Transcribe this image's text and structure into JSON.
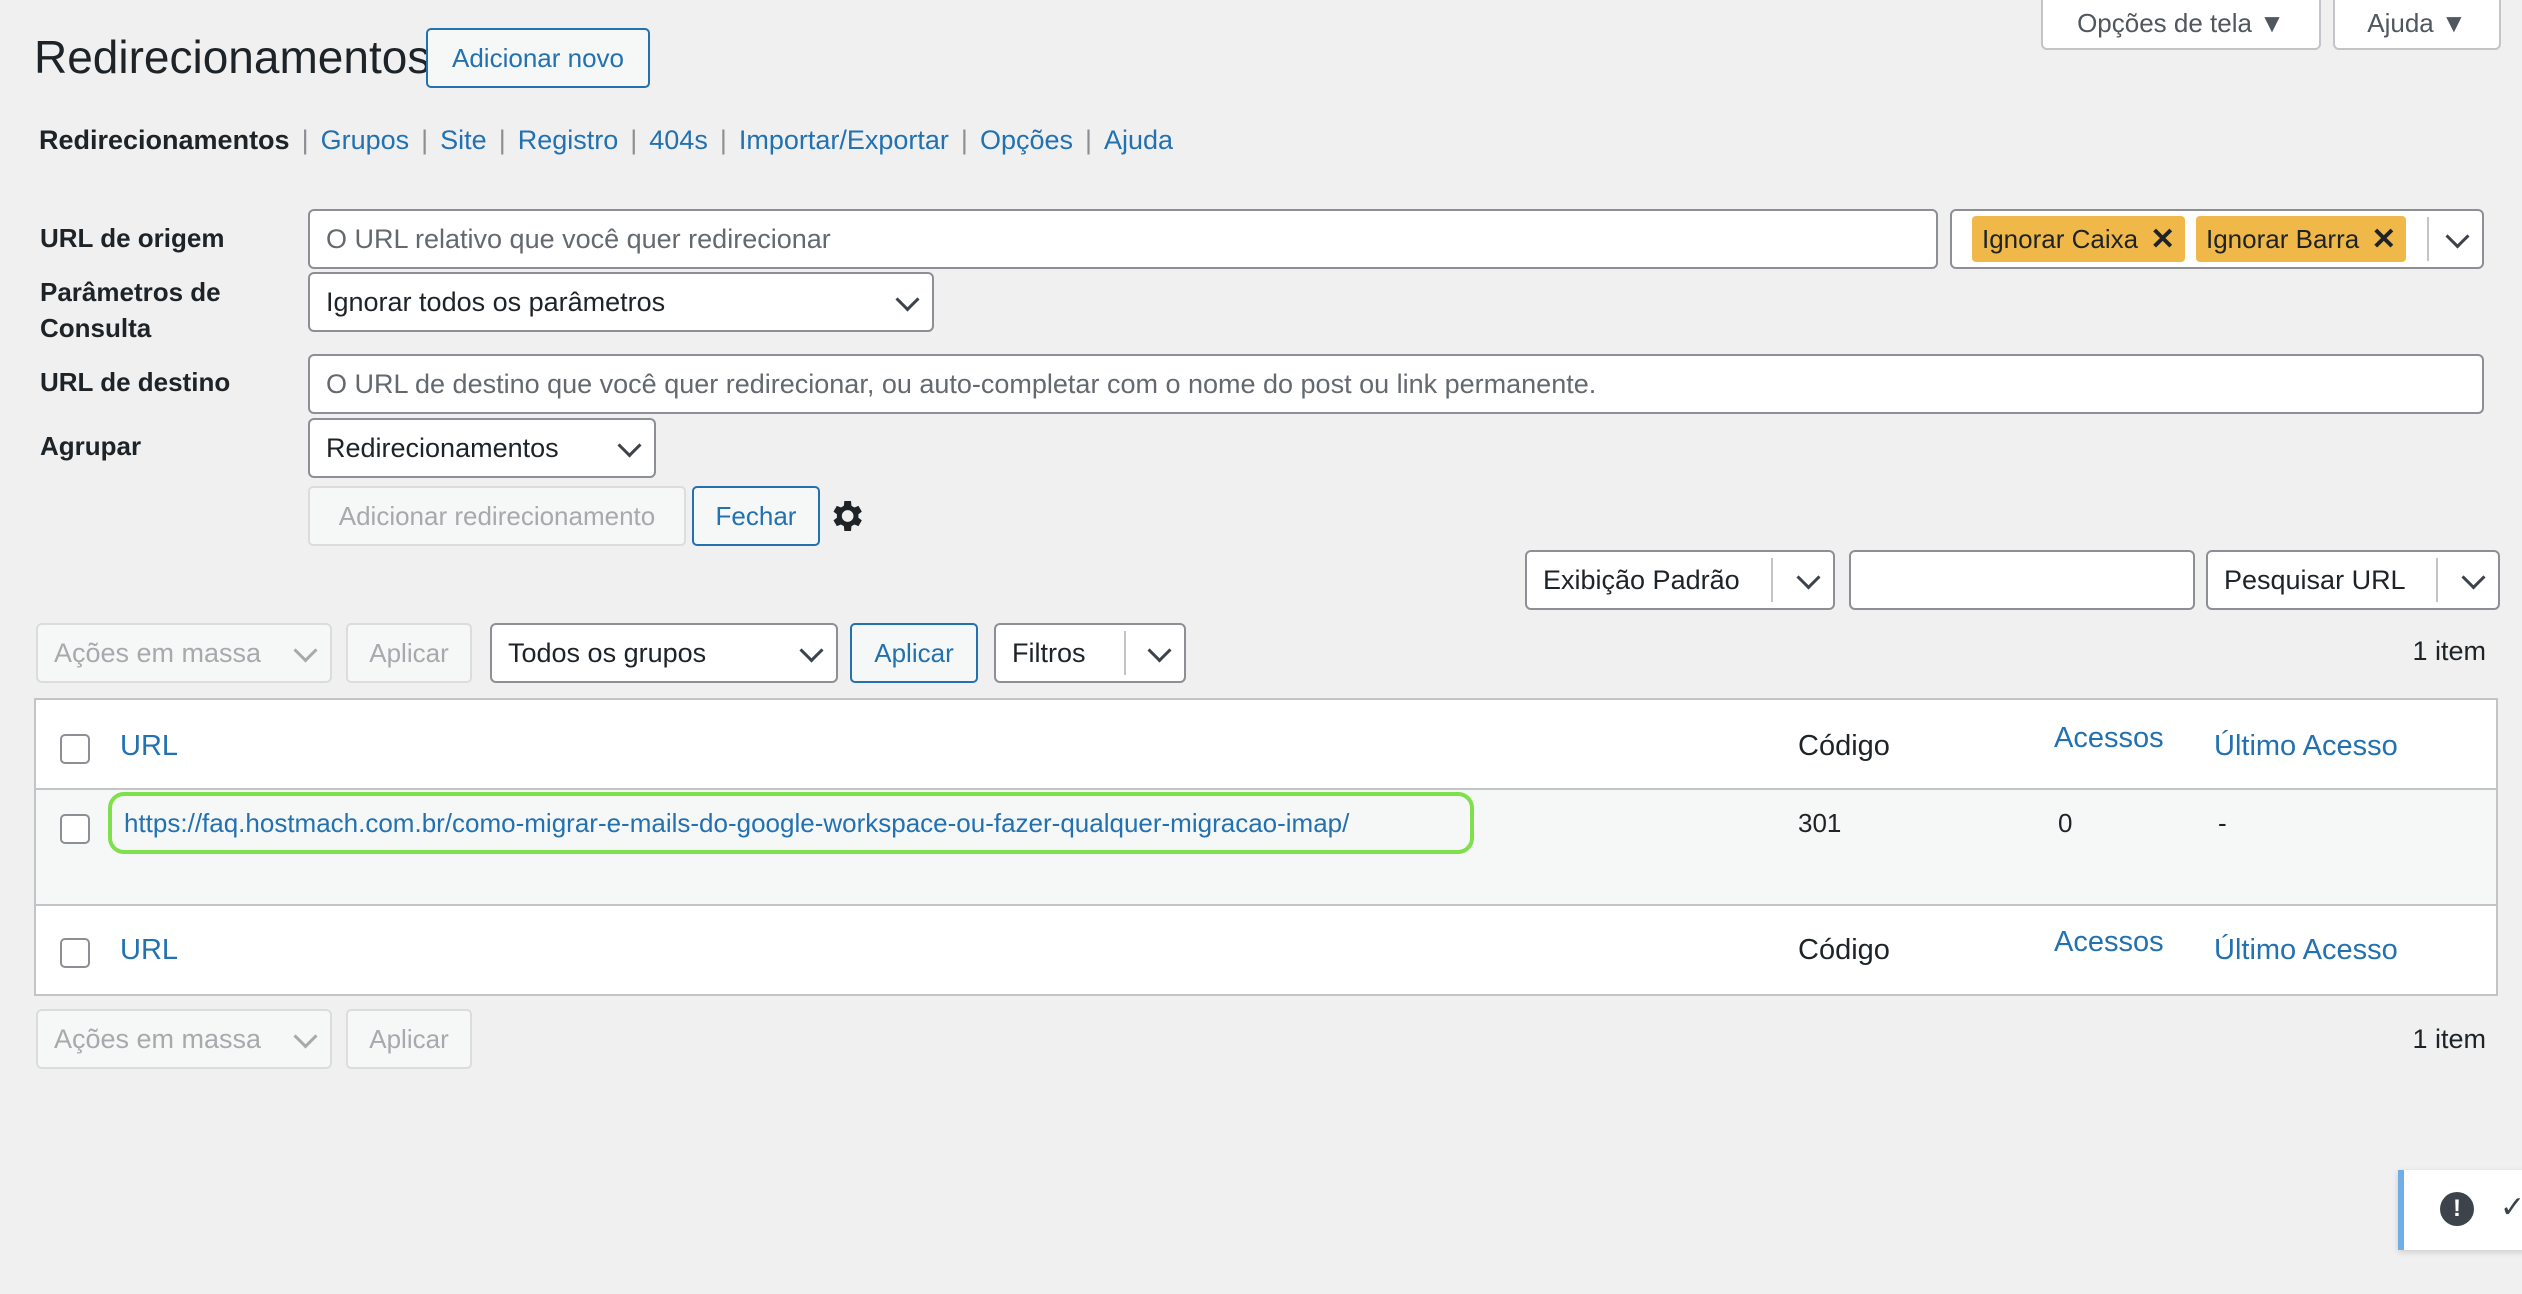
{
  "header": {
    "title": "Redirecionamentos",
    "add_new": "Adicionar novo",
    "screen_options": "Opções de tela ▼",
    "help": "Ajuda ▼"
  },
  "subnav": {
    "items": [
      "Redirecionamentos",
      "Grupos",
      "Site",
      "Registro",
      "404s",
      "Importar/Exportar",
      "Opções",
      "Ajuda"
    ],
    "separator": "|"
  },
  "form": {
    "source_label": "URL de origem",
    "source_placeholder": "O URL relativo que você quer redirecionar",
    "tag_case": "Ignorar Caixa",
    "tag_slash": "Ignorar Barra",
    "tag_remove": "✕",
    "query_label": "Parâmetros de Consulta",
    "query_value": "Ignorar todos os parâmetros",
    "target_label": "URL de destino",
    "target_placeholder": "O URL de destino que você quer redirecionar, ou auto-completar com o nome do post ou link permanente.",
    "group_label": "Agrupar",
    "group_value": "Redirecionamentos",
    "add_redirect": "Adicionar redirecionamento",
    "close": "Fechar"
  },
  "search": {
    "view_select": "Exibição Padrão",
    "search_value": "",
    "search_type": "Pesquisar URL"
  },
  "toolbar": {
    "bulk_actions": "Ações em massa",
    "apply": "Aplicar",
    "groups_select": "Todos os grupos",
    "apply_group": "Aplicar",
    "filters": "Filtros",
    "count": "1 item"
  },
  "table": {
    "columns": [
      "URL",
      "Código",
      "Acessos",
      "Último Acesso"
    ],
    "rows": [
      {
        "url": "https://faq.hostmach.com.br/como-migrar-e-mails-do-google-workspace-ou-fazer-qualquer-migracao-imap/",
        "code": "301",
        "hits": "0",
        "last": "-"
      }
    ]
  },
  "notice": {
    "alert_icon": "!",
    "check_icon": "✓"
  },
  "colors": {
    "accent": "#2271b1",
    "tag": "#f0b849",
    "highlight": "#7ee04a"
  }
}
